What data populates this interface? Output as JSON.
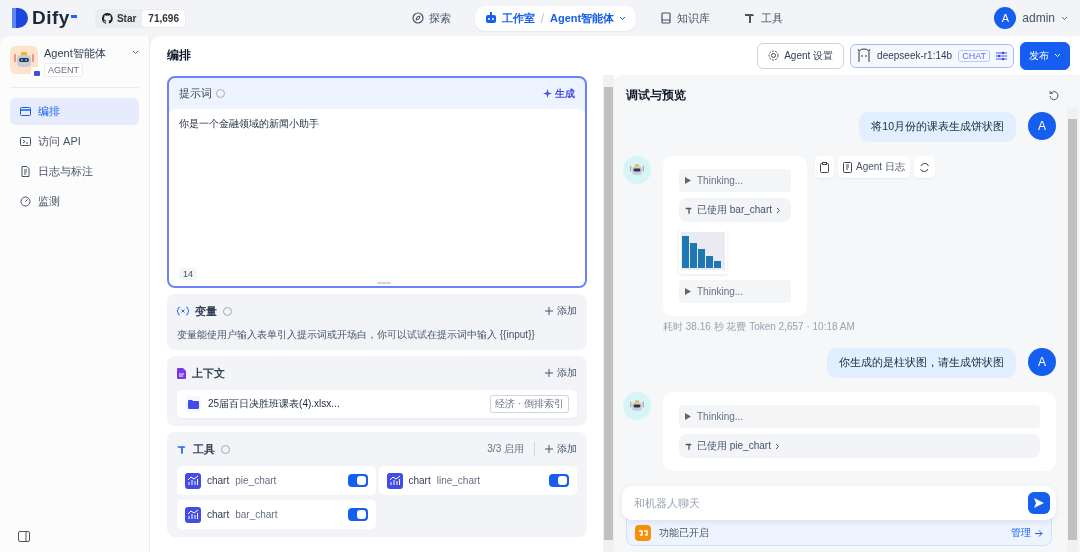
{
  "nav": {
    "logo": "Dify",
    "star_label": "Star",
    "star_count": "71,696",
    "items": [
      {
        "label": "探索",
        "selected": false
      },
      {
        "label": "工作室",
        "selected": true,
        "crumb": "Agent智能体"
      },
      {
        "label": "知识库",
        "selected": false
      },
      {
        "label": "工具",
        "selected": false
      }
    ],
    "user": {
      "avatar": "A",
      "name": "admin"
    }
  },
  "sidebar": {
    "app_name": "Agent智能体",
    "app_type": "AGENT",
    "items": [
      {
        "label": "编排",
        "selected": true
      },
      {
        "label": "访问 API",
        "selected": false
      },
      {
        "label": "日志与标注",
        "selected": false
      },
      {
        "label": "监测",
        "selected": false
      }
    ]
  },
  "header": {
    "title": "编排",
    "settings_button": "Agent 设置",
    "model": {
      "name": "deepseek-r1:14b",
      "badge": "CHAT"
    },
    "publish_button": "发布"
  },
  "prompt": {
    "title": "提示词",
    "generate_button": "生成",
    "text": "你是一个金融领域的新闻小助手",
    "count": "14"
  },
  "variables": {
    "title": "变量",
    "add": "添加",
    "hint": "变量能使用户输入表单引入提示词或开场白，你可以试试在提示词中输入 {{input}}"
  },
  "context": {
    "title": "上下文",
    "add": "添加",
    "files": [
      {
        "name": "25届百日决胜班课表(4).xlsx...",
        "tag": "经济 · 倒排索引"
      }
    ]
  },
  "tools": {
    "title": "工具",
    "enabled": "3/3 启用",
    "add": "添加",
    "items": [
      {
        "provider": "chart",
        "name": "pie_chart",
        "on": true
      },
      {
        "provider": "chart",
        "name": "line_chart",
        "on": true
      },
      {
        "provider": "chart",
        "name": "bar_chart",
        "on": true
      }
    ]
  },
  "debug": {
    "title": "调试与预览",
    "messages": [
      {
        "kind": "user",
        "avatar": "A",
        "text": "将10月份的课表生成饼状图"
      },
      {
        "kind": "assistant",
        "full_width": false,
        "blocks": [
          {
            "kind": "thinking",
            "text": "Thinking..."
          },
          {
            "kind": "tool",
            "prefix": "已使用",
            "name": "bar_chart"
          },
          {
            "kind": "image"
          },
          {
            "kind": "thinking",
            "text": "Thinking..."
          }
        ],
        "log_button": "Agent 日志",
        "meta": "耗时 38.16 秒  花费 Token 2,657  ·  10:18 AM"
      },
      {
        "kind": "user",
        "avatar": "A",
        "text": "你生成的是柱状图，请生成饼状图"
      },
      {
        "kind": "assistant",
        "full_width": true,
        "blocks": [
          {
            "kind": "thinking",
            "text": "Thinking..."
          },
          {
            "kind": "tool",
            "prefix": "已使用",
            "name": "pie_chart"
          }
        ]
      }
    ],
    "input": {
      "placeholder": "和机器人聊天"
    },
    "features": {
      "text": "功能已开启",
      "manage": "管理"
    }
  }
}
